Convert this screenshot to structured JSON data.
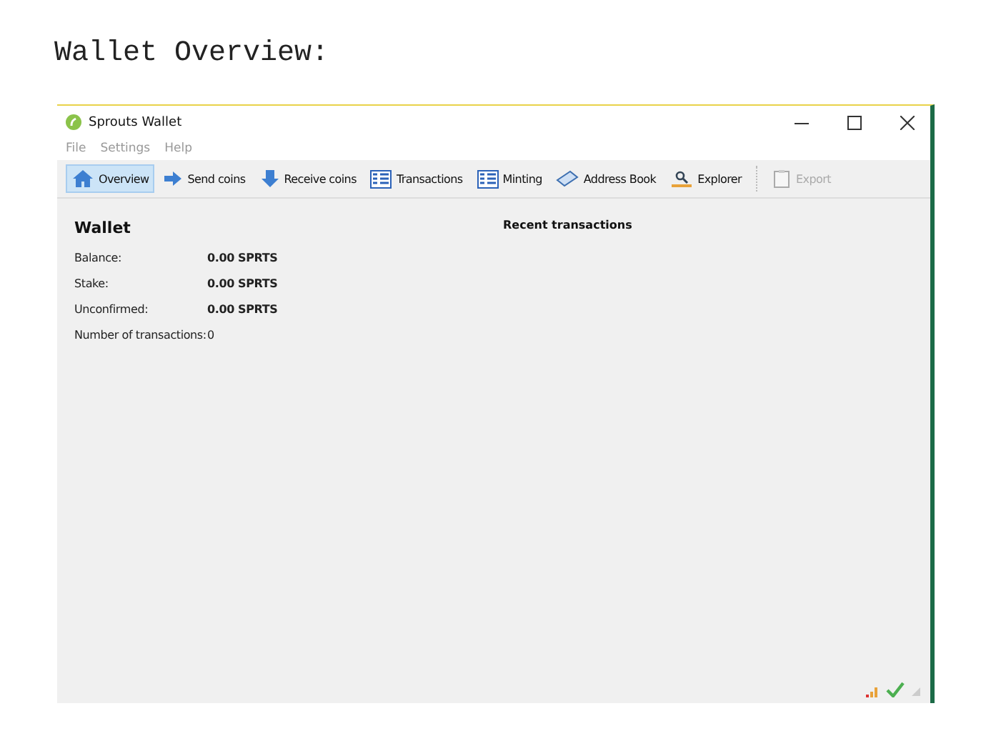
{
  "heading": "Wallet Overview:",
  "window": {
    "title": "Sprouts Wallet"
  },
  "menu": [
    {
      "label": "File"
    },
    {
      "label": "Settings"
    },
    {
      "label": "Help"
    }
  ],
  "toolbar": [
    {
      "label": "Overview",
      "kind": "home",
      "selected": true,
      "disabled": false
    },
    {
      "label": "Send coins",
      "kind": "send",
      "selected": false,
      "disabled": false
    },
    {
      "label": "Receive coins",
      "kind": "receive",
      "selected": false,
      "disabled": false
    },
    {
      "label": "Transactions",
      "kind": "list",
      "selected": false,
      "disabled": false
    },
    {
      "label": "Minting",
      "kind": "list",
      "selected": false,
      "disabled": false
    },
    {
      "label": "Address Book",
      "kind": "book",
      "selected": false,
      "disabled": false
    },
    {
      "label": "Explorer",
      "kind": "explorer",
      "selected": false,
      "disabled": false
    },
    {
      "label": "Export",
      "kind": "export",
      "selected": false,
      "disabled": true
    }
  ],
  "wallet": {
    "title": "Wallet",
    "rows": [
      {
        "label": "Balance:",
        "value": "0.00 SPRTS",
        "bold": true
      },
      {
        "label": "Stake:",
        "value": "0.00 SPRTS",
        "bold": true
      },
      {
        "label": "Unconfirmed:",
        "value": "0.00 SPRTS",
        "bold": true
      },
      {
        "label": "Number of transactions:",
        "value": "0",
        "bold": false
      }
    ]
  },
  "recent": {
    "title": "Recent transactions"
  }
}
